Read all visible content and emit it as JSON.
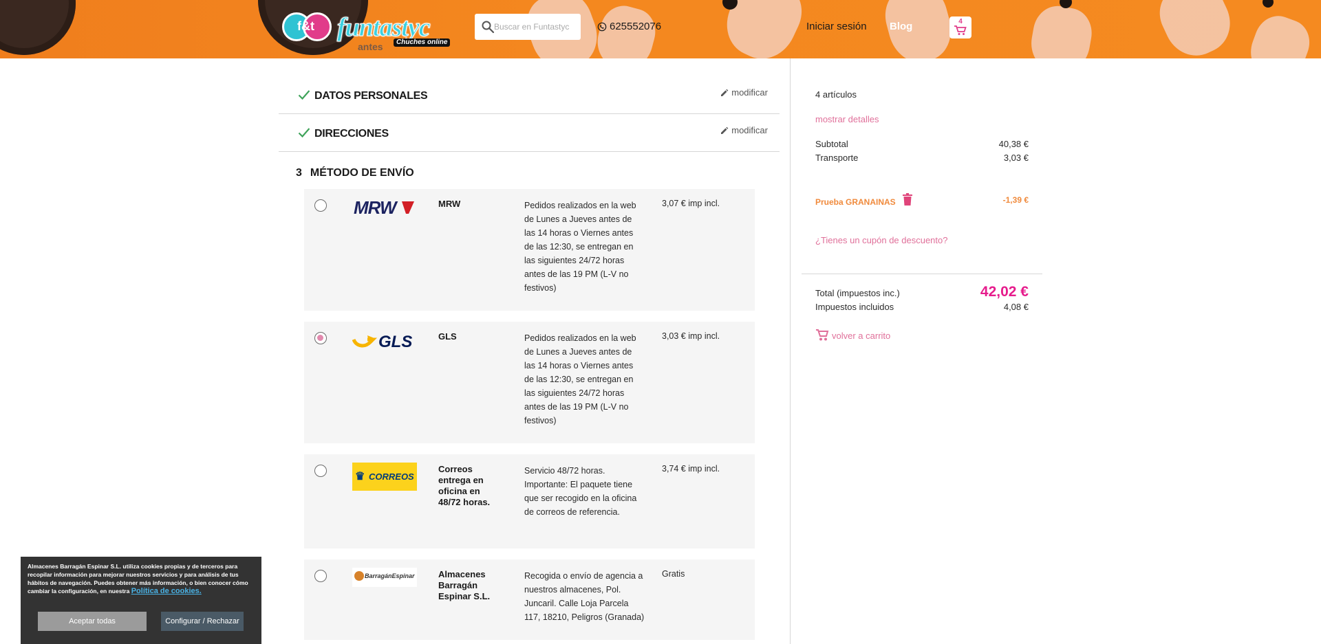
{
  "header": {
    "logo": {
      "text": "funtastyc",
      "antes": "antes",
      "sub": "Chuches online"
    },
    "search": {
      "placeholder": "Buscar en Funtastyc"
    },
    "phone": "625552076",
    "login": "Iniciar sesión",
    "blog": "Blog",
    "cart_count": "4"
  },
  "steps": [
    {
      "title": "DATOS PERSONALES",
      "edit": "modificar"
    },
    {
      "title": "DIRECCIONES",
      "edit": "modificar"
    }
  ],
  "step3": {
    "number": "3",
    "title": "MÉTODO DE ENVÍO"
  },
  "carriers": [
    {
      "name": "MRW",
      "description": "Pedidos realizados en la web de Lunes a Jueves antes de las 14 horas o Viernes antes de las 12:30, se entregan en las siguientes 24/72 horas antes de las 19 PM (L-V no festivos)",
      "price": "3,07 € imp incl.",
      "logo": "mrw-logo",
      "selected": false
    },
    {
      "name": "GLS",
      "description": "Pedidos realizados en la web de Lunes a Jueves antes de las 14 horas o Viernes antes de las 12:30, se entregan en las siguientes 24/72 horas antes de las 19 PM (L-V no festivos)",
      "price": "3,03 € imp incl.",
      "logo": "gls-logo",
      "selected": true
    },
    {
      "name": "Correos entrega en oficina en 48/72 horas.",
      "description": "Servicio 48/72 horas. Importante: El paquete tiene que ser recogido en la oficina de correos de referencia.",
      "price": "3,74 € imp incl.",
      "logo": "correos-logo",
      "logo_text": "CORREOS",
      "selected": false
    },
    {
      "name": "Almacenes Barragán Espinar S.L.",
      "description": "Recogida o envío de agencia a nuestros almacenes, Pol. Juncaril. Calle Loja Parcela 117, 18210, Peligros (Granada)",
      "price": "Gratis",
      "logo": "barragan-logo",
      "logo_text": "BarragánEspinar",
      "selected": false
    }
  ],
  "summary": {
    "items_count": "4 artículos",
    "show_details": "mostrar detalles",
    "subtotal_label": "Subtotal",
    "subtotal_value": "40,38 €",
    "shipping_label": "Transporte",
    "shipping_value": "3,03 €",
    "voucher_name": "Prueba GRANAINAS",
    "voucher_value": "-1,39 €",
    "coupon_link": "¿Tienes un cupón de descuento?",
    "total_label": "Total (impuestos inc.)",
    "total_value": "42,02 €",
    "taxes_label": "Impuestos incluidos",
    "taxes_value": "4,08 €",
    "back_to_cart": "volver a carrito"
  },
  "cookie_banner": {
    "text": "Almacenes Barragán Espinar S.L. utiliza cookies propias y de terceros para recopilar información para mejorar nuestros servicios y para análisis de tus hábitos de navegación. Puedes obtener más información, o bien conocer cómo cambiar la configuración, en nuestra",
    "link": "Política de cookies.",
    "accept": "Aceptar todas",
    "configure": "Configurar / Rechazar"
  },
  "colors": {
    "header_orange": "#f4881f",
    "accent_pink": "#e0709a",
    "total_magenta": "#e61c8c",
    "voucher_orange": "#f08a3c",
    "check_green": "#3fa35a"
  }
}
